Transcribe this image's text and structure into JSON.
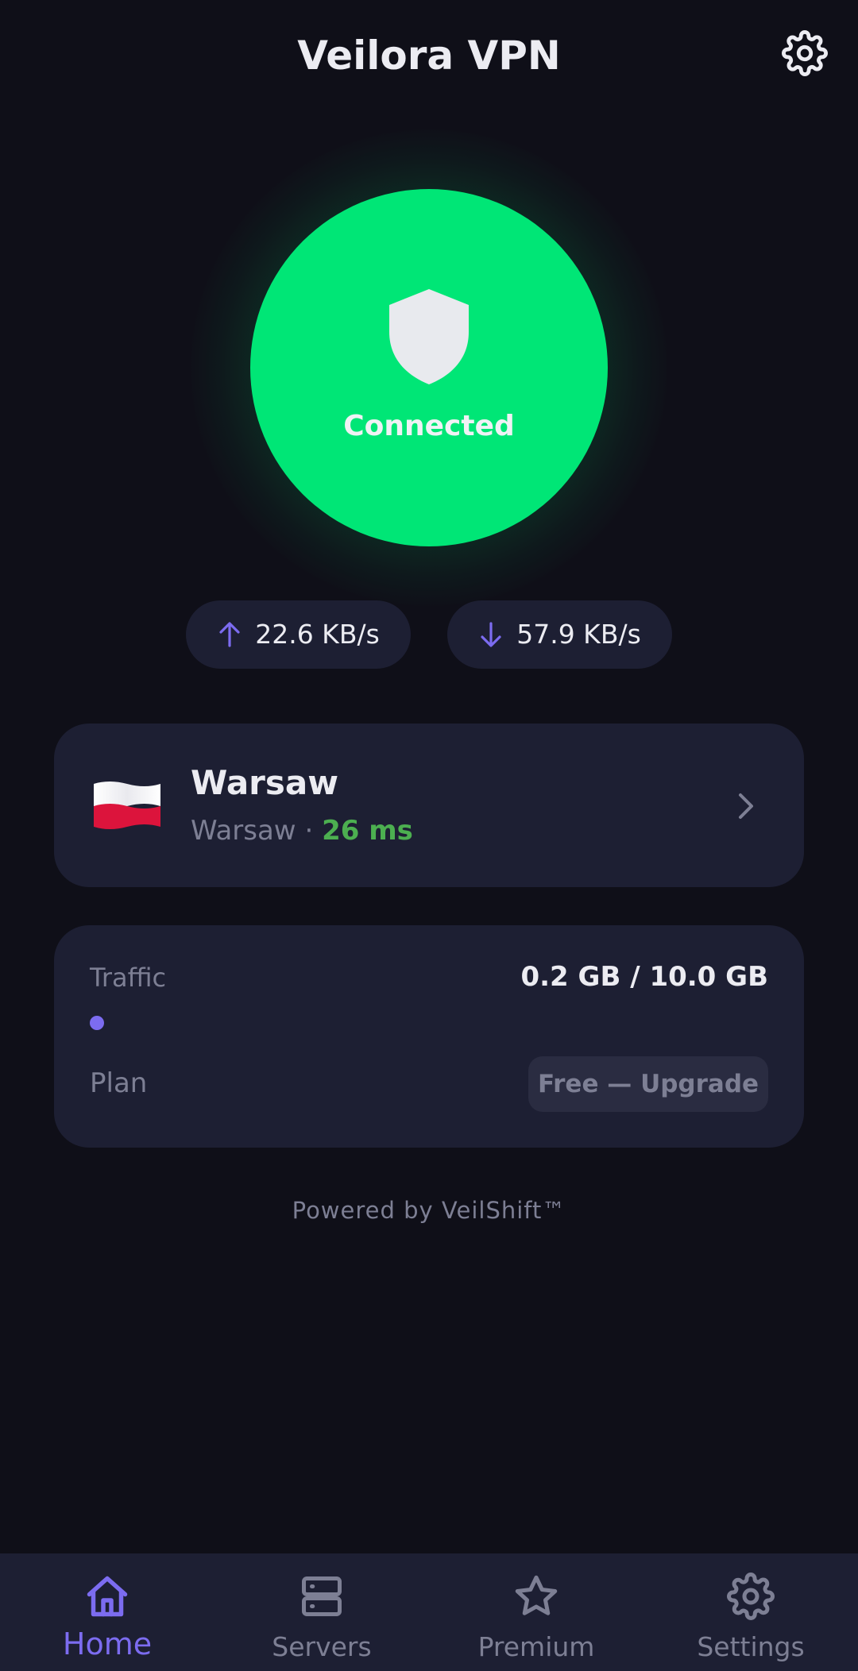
{
  "header": {
    "title": "Veilora VPN",
    "settings_icon": "gear-icon"
  },
  "connection": {
    "status": "Connected",
    "icon": "shield-icon",
    "accent_color": "#00e676"
  },
  "speeds": {
    "upload": "22.6 KB/s",
    "download": "57.9 KB/s"
  },
  "server": {
    "flag": "poland-flag",
    "name": "Warsaw",
    "city": "Warsaw",
    "separator": "·",
    "ping": "26 ms"
  },
  "traffic": {
    "label": "Traffic",
    "value": "0.2 GB / 10.0 GB",
    "used_fraction": 0.02,
    "plan_label": "Plan",
    "upgrade_label": "Free — Upgrade"
  },
  "footer": {
    "powered_by": "Powered by VeilShift™"
  },
  "nav": {
    "items": [
      {
        "label": "Home",
        "icon": "home-icon",
        "active": true
      },
      {
        "label": "Servers",
        "icon": "servers-icon",
        "active": false
      },
      {
        "label": "Premium",
        "icon": "star-icon",
        "active": false
      },
      {
        "label": "Settings",
        "icon": "gear-icon",
        "active": false
      }
    ]
  },
  "colors": {
    "background": "#0f0f18",
    "card": "#1d1f33",
    "accent_purple": "#7c6cf0",
    "ping_green": "#4caf50"
  }
}
